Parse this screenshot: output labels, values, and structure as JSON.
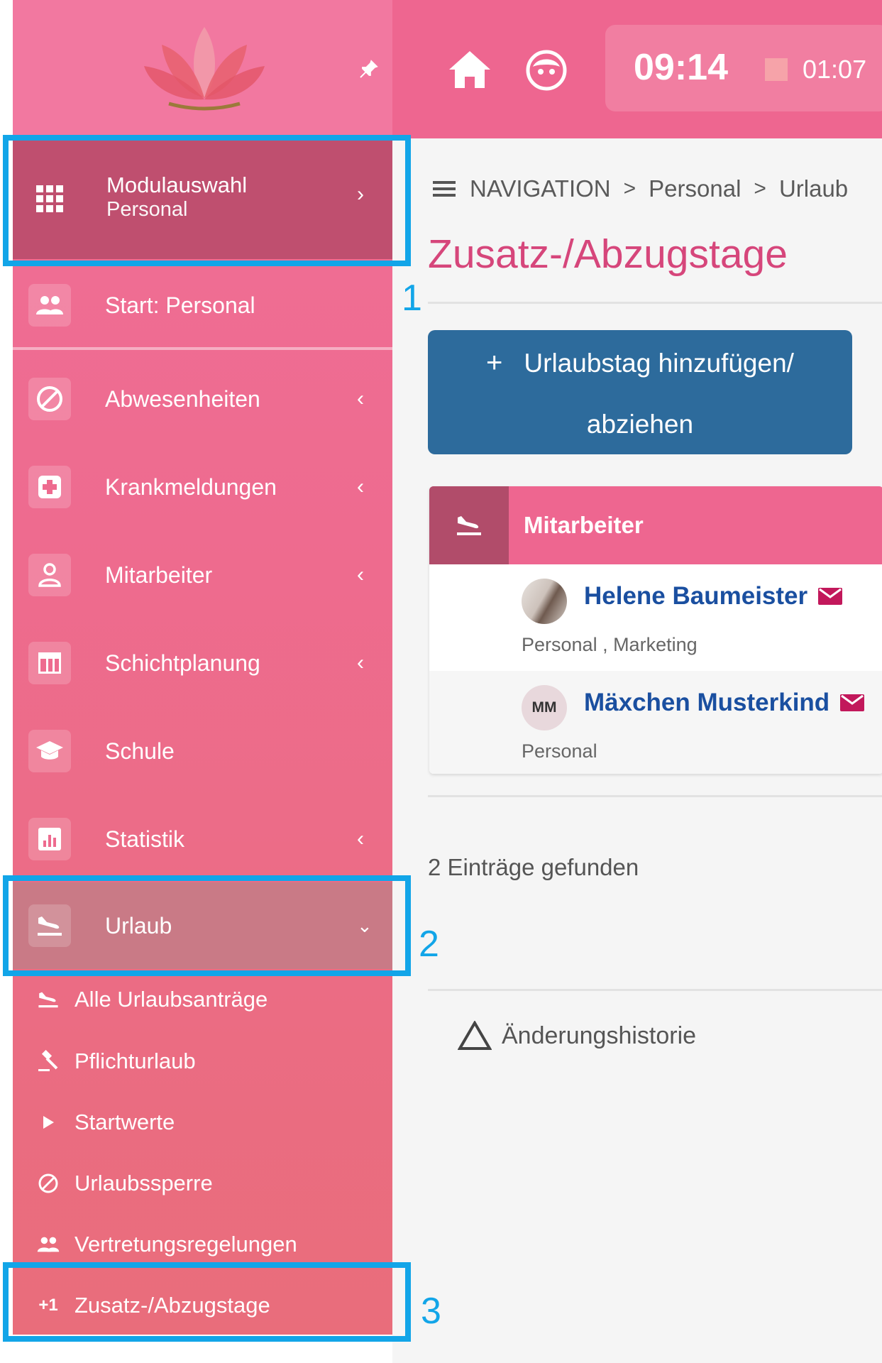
{
  "sidebar": {
    "modulauswahl": {
      "title": "Modulauswahl",
      "subtitle": "Personal"
    },
    "items": [
      {
        "label": "Start: Personal",
        "icon": "people-icon"
      },
      {
        "label": "Abwesenheiten",
        "icon": "block-icon",
        "chevron": "‹"
      },
      {
        "label": "Krankmeldungen",
        "icon": "medical-cross-icon",
        "chevron": "‹"
      },
      {
        "label": "Mitarbeiter",
        "icon": "person-icon",
        "chevron": "‹"
      },
      {
        "label": "Schichtplanung",
        "icon": "table-icon",
        "chevron": "‹"
      },
      {
        "label": "Schule",
        "icon": "graduation-cap-icon"
      },
      {
        "label": "Statistik",
        "icon": "bar-chart-icon",
        "chevron": "‹"
      },
      {
        "label": "Urlaub",
        "icon": "airplane-landing-icon",
        "chevron": "⌄"
      }
    ],
    "subitems": [
      {
        "label": "Alle Urlaubsanträge",
        "icon": "airplane-landing-icon"
      },
      {
        "label": "Pflichturlaub",
        "icon": "gavel-icon"
      },
      {
        "label": "Startwerte",
        "icon": "play-icon"
      },
      {
        "label": "Urlaubssperre",
        "icon": "block-icon"
      },
      {
        "label": "Vertretungsregelungen",
        "icon": "people-icon"
      },
      {
        "label": "Zusatz-/Abzugstage",
        "icon": "plus-one-icon",
        "prefix": "+1"
      }
    ]
  },
  "topbar": {
    "time": "09:14",
    "elapsed": "01:07"
  },
  "breadcrumb": {
    "root": "NAVIGATION",
    "level1": "Personal",
    "level2": "Urlaub",
    "separator": ">"
  },
  "page": {
    "title": "Zusatz-/Abzugstage",
    "add_button": {
      "plus": "+",
      "line1": "Urlaubstag hinzufügen/",
      "line2": "abziehen"
    },
    "card": {
      "title": "Mitarbeiter",
      "people": [
        {
          "name": "Helene Baumeister",
          "departments": "Personal , Marketing",
          "avatar": "photo"
        },
        {
          "name": "Mäxchen Musterkind",
          "departments": "Personal",
          "initials": "MM"
        }
      ]
    },
    "count_text": "2 Einträge gefunden",
    "history_label": "Änderungshistorie"
  },
  "annotations": [
    "1",
    "2",
    "3"
  ],
  "colors": {
    "sidebar": "#ee6b8f",
    "topbar": "#ee6690",
    "primary_button": "#2d6b9c",
    "title": "#d6467b",
    "link": "#1a4fa0",
    "highlight": "#12a5e8"
  }
}
